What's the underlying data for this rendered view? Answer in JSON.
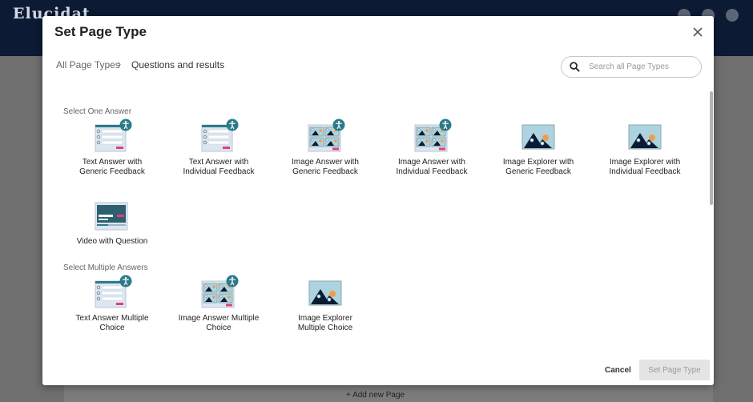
{
  "app": {
    "logo_text": "Elucidat",
    "add_new_page": "+ Add new Page"
  },
  "modal": {
    "title": "Set Page Type",
    "breadcrumb": {
      "root": "All Page Types",
      "separator": "›",
      "current": "Questions and results"
    },
    "search": {
      "placeholder": "Search all Page Types",
      "value": ""
    },
    "sections": [
      {
        "heading": "Select One Answer",
        "items": [
          {
            "line1": "Text Answer with",
            "line2": "Generic Feedback",
            "kind": "text",
            "accessible": true
          },
          {
            "line1": "Text Answer with",
            "line2": "Individual Feedback",
            "kind": "text",
            "accessible": true
          },
          {
            "line1": "Image Answer with",
            "line2": "Generic Feedback",
            "kind": "image-grid",
            "accessible": true
          },
          {
            "line1": "Image Answer with",
            "line2": "Individual Feedback",
            "kind": "image-grid",
            "accessible": true
          },
          {
            "line1": "Image Explorer with",
            "line2": "Generic Feedback",
            "kind": "explorer",
            "accessible": false
          },
          {
            "line1": "Image Explorer with",
            "line2": "Individual Feedback",
            "kind": "explorer",
            "accessible": false
          },
          {
            "line1": "Video with Question",
            "line2": "",
            "kind": "video",
            "accessible": false
          }
        ]
      },
      {
        "heading": "Select Multiple Answers",
        "items": [
          {
            "line1": "Text Answer Multiple",
            "line2": "Choice",
            "kind": "text",
            "accessible": true
          },
          {
            "line1": "Image Answer Multiple",
            "line2": "Choice",
            "kind": "image-grid",
            "accessible": true
          },
          {
            "line1": "Image Explorer",
            "line2": "Multiple Choice",
            "kind": "explorer",
            "accessible": false
          }
        ]
      }
    ],
    "footer": {
      "cancel_label": "Cancel",
      "submit_label": "Set Page Type"
    }
  },
  "colors": {
    "accent_teal": "#2b7a8c",
    "accent_pink": "#e0407a",
    "accent_orange": "#f29b4a",
    "dark_navy": "#0c1a33"
  }
}
